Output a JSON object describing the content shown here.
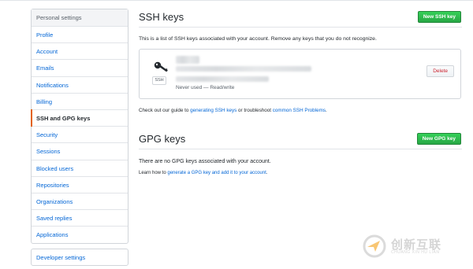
{
  "sidebar": {
    "header": "Personal settings",
    "items": [
      {
        "label": "Profile"
      },
      {
        "label": "Account"
      },
      {
        "label": "Emails"
      },
      {
        "label": "Notifications"
      },
      {
        "label": "Billing"
      },
      {
        "label": "SSH and GPG keys",
        "active": true
      },
      {
        "label": "Security"
      },
      {
        "label": "Sessions"
      },
      {
        "label": "Blocked users"
      },
      {
        "label": "Repositories"
      },
      {
        "label": "Organizations"
      },
      {
        "label": "Saved replies"
      },
      {
        "label": "Applications"
      }
    ],
    "developer_settings": "Developer settings"
  },
  "ssh": {
    "title": "SSH keys",
    "new_button": "New SSH key",
    "description": "This is a list of SSH keys associated with your account. Remove any keys that you do not recognize.",
    "key": {
      "badge": "SSH",
      "meta": "Never used — Read/write",
      "delete_label": "Delete"
    },
    "guide": {
      "prefix": "Check out our guide to ",
      "link1": "generating SSH keys",
      "middle": " or troubleshoot ",
      "link2": "common SSH Problems",
      "suffix": "."
    }
  },
  "gpg": {
    "title": "GPG keys",
    "new_button": "New GPG key",
    "empty": "There are no GPG keys associated with your account.",
    "learn": {
      "prefix": "Learn how to ",
      "link": "generate a GPG key and add it to your account",
      "suffix": "."
    }
  },
  "watermark": {
    "text": "创新互联",
    "subtext": "CHUANG XIN HU LIAN"
  },
  "colors": {
    "link": "#0366d6",
    "green": "#28a745",
    "danger": "#cb2431",
    "active_marker": "#e36209"
  }
}
